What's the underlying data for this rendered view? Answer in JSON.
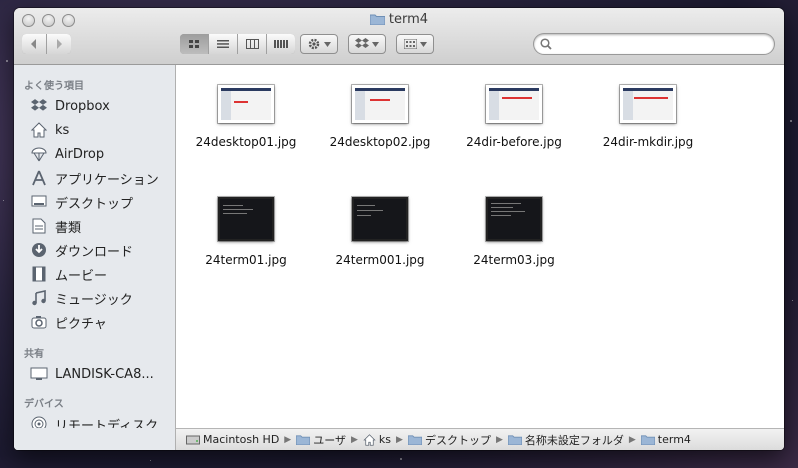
{
  "window": {
    "title": "term4"
  },
  "toolbar": {
    "back_icon": "chevron-left-icon",
    "forward_icon": "chevron-right-icon",
    "views": [
      "icon-view",
      "list-view",
      "column-view",
      "coverflow-view"
    ],
    "action_icon": "gear-icon",
    "dropbox_icon": "dropbox-icon",
    "arrange_icon": "arrange-grid-icon",
    "search_placeholder": ""
  },
  "sidebar": {
    "favorites_header": "よく使う項目",
    "favorites": [
      {
        "label": "Dropbox",
        "icon": "dropbox-icon"
      },
      {
        "label": "ks",
        "icon": "home-icon"
      },
      {
        "label": "AirDrop",
        "icon": "airdrop-icon"
      },
      {
        "label": "アプリケーション",
        "icon": "applications-icon"
      },
      {
        "label": "デスクトップ",
        "icon": "desktop-icon"
      },
      {
        "label": "書類",
        "icon": "documents-icon"
      },
      {
        "label": "ダウンロード",
        "icon": "downloads-icon"
      },
      {
        "label": "ムービー",
        "icon": "movies-icon"
      },
      {
        "label": "ミュージック",
        "icon": "music-icon"
      },
      {
        "label": "ピクチャ",
        "icon": "pictures-icon"
      }
    ],
    "shared_header": "共有",
    "shared": [
      {
        "label": "LANDISK-CA8...",
        "icon": "network-drive-icon"
      }
    ],
    "devices_header": "デバイス",
    "devices": [
      {
        "label": "リモートディスク",
        "icon": "remote-disc-icon"
      }
    ]
  },
  "files": [
    {
      "name": "24desktop01.jpg",
      "kind": "desktop"
    },
    {
      "name": "24desktop02.jpg",
      "kind": "desktop"
    },
    {
      "name": "24dir-before.jpg",
      "kind": "desktop"
    },
    {
      "name": "24dir-mkdir.jpg",
      "kind": "desktop"
    },
    {
      "name": "24term01.jpg",
      "kind": "terminal"
    },
    {
      "name": "24term001.jpg",
      "kind": "terminal"
    },
    {
      "name": "24term03.jpg",
      "kind": "terminal"
    }
  ],
  "pathbar": [
    "Macintosh HD",
    "ユーザ",
    "ks",
    "デスクトップ",
    "名称未設定フォルダ",
    "term4"
  ]
}
